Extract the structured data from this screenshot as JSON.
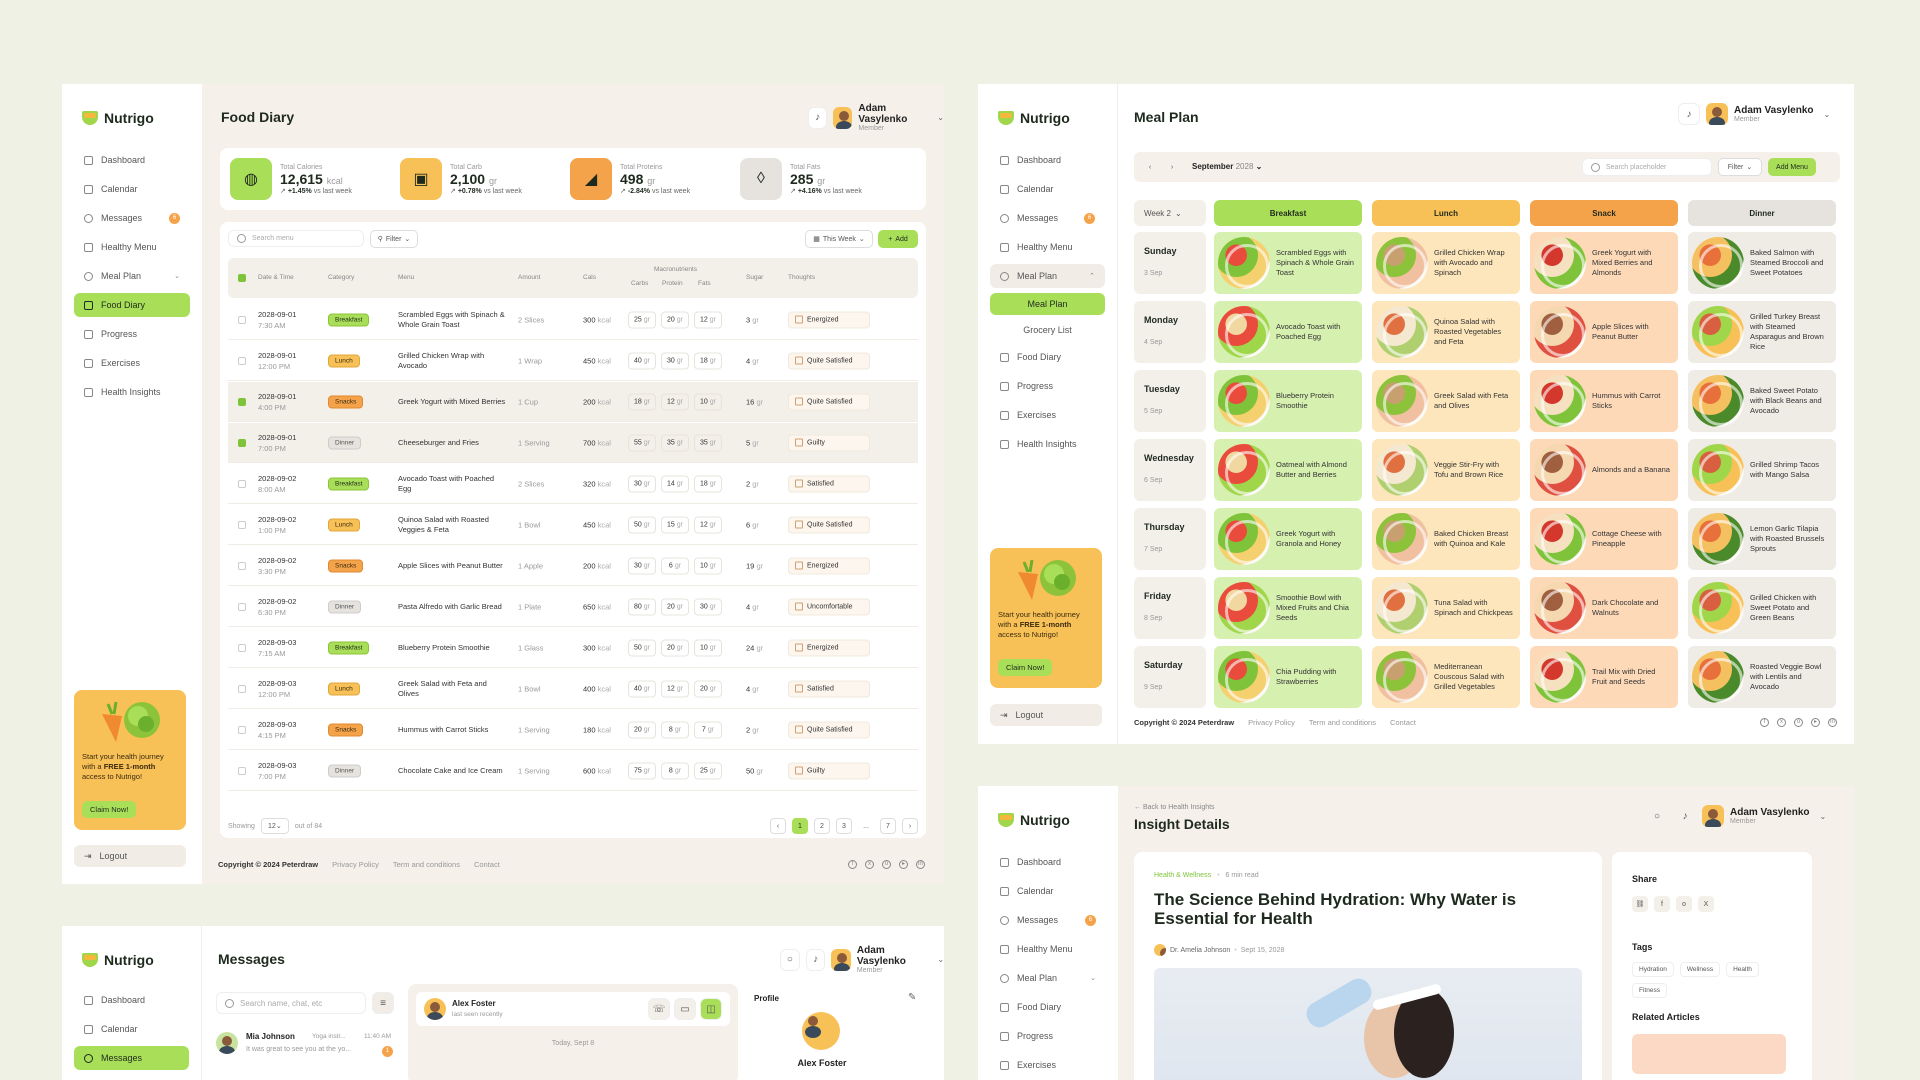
{
  "brand": "Nutrigo",
  "user": {
    "name": "Adam Vasylenko",
    "role": "Member"
  },
  "nav": {
    "dashboard": "Dashboard",
    "calendar": "Calendar",
    "messages": "Messages",
    "messages_badge": "6",
    "healthy_menu": "Healthy Menu",
    "meal_plan": "Meal Plan",
    "food_diary": "Food Diary",
    "progress": "Progress",
    "exercises": "Exercises",
    "health_insights": "Health Insights",
    "sub_meal_plan": "Meal Plan",
    "sub_grocery": "Grocery List",
    "logout": "Logout"
  },
  "promo": {
    "text_pre": "Start your health journey with a ",
    "text_bold": "FREE 1-month",
    "text_post": " access to Nutrigo!",
    "button": "Claim Now!"
  },
  "footer": {
    "copyright": "Copyright © 2024 Peterdraw",
    "privacy": "Privacy Policy",
    "terms": "Term and conditions",
    "contact": "Contact"
  },
  "food_diary": {
    "title": "Food Diary",
    "stats": [
      {
        "label": "Total Calories",
        "value": "12,615",
        "unit": "kcal",
        "change": "+1.45%",
        "suffix": "vs last week",
        "color": "#a9df58",
        "icon": "apple-icon"
      },
      {
        "label": "Total Carb",
        "value": "2,100",
        "unit": "gr",
        "change": "+0.78%",
        "suffix": "vs last week",
        "color": "#f8c157",
        "icon": "bread-icon"
      },
      {
        "label": "Total Proteins",
        "value": "498",
        "unit": "gr",
        "change": "-2.84%",
        "suffix": "vs last week",
        "color": "#f5a34a",
        "icon": "drumstick-icon"
      },
      {
        "label": "Total Fats",
        "value": "285",
        "unit": "gr",
        "change": "+4.16%",
        "suffix": "vs last week",
        "color": "#e6e3de",
        "icon": "drop-icon"
      }
    ],
    "search_placeholder": "Search menu",
    "filter": "Filter",
    "range": "This Week",
    "add": "Add",
    "headers": {
      "date": "Date & Time",
      "category": "Category",
      "menu": "Menu",
      "amount": "Amount",
      "cals": "Cals",
      "macros": "Macronutrients",
      "carbs": "Carbs",
      "protein": "Protein",
      "fats": "Fats",
      "sugar": "Sugar",
      "thoughts": "Thoughts"
    },
    "rows": [
      {
        "date": "2028-09-01",
        "time": "7:30 AM",
        "cat": "Breakfast",
        "menu": "Scrambled Eggs with Spinach & Whole Grain Toast",
        "amount": "2 Slices",
        "cals": "300",
        "carbs": "25",
        "protein": "20",
        "fats": "12",
        "sugar": "3",
        "thought": "Energized",
        "checked": false
      },
      {
        "date": "2028-09-01",
        "time": "12:00 PM",
        "cat": "Lunch",
        "menu": "Grilled Chicken Wrap with Avocado",
        "amount": "1 Wrap",
        "cals": "450",
        "carbs": "40",
        "protein": "30",
        "fats": "18",
        "sugar": "4",
        "thought": "Quite Satisfied",
        "checked": false
      },
      {
        "date": "2028-09-01",
        "time": "4:00 PM",
        "cat": "Snacks",
        "menu": "Greek Yogurt with Mixed Berries",
        "amount": "1 Cup",
        "cals": "200",
        "carbs": "18",
        "protein": "12",
        "fats": "10",
        "sugar": "16",
        "thought": "Quite Satisfied",
        "checked": true
      },
      {
        "date": "2028-09-01",
        "time": "7:00 PM",
        "cat": "Dinner",
        "menu": "Cheeseburger and Fries",
        "amount": "1 Serving",
        "cals": "700",
        "carbs": "55",
        "protein": "35",
        "fats": "35",
        "sugar": "5",
        "thought": "Guilty",
        "checked": true
      },
      {
        "date": "2028-09-02",
        "time": "8:00 AM",
        "cat": "Breakfast",
        "menu": "Avocado Toast with Poached Egg",
        "amount": "2 Slices",
        "cals": "320",
        "carbs": "30",
        "protein": "14",
        "fats": "18",
        "sugar": "2",
        "thought": "Satisfied",
        "checked": false
      },
      {
        "date": "2028-09-02",
        "time": "1:00 PM",
        "cat": "Lunch",
        "menu": "Quinoa Salad with Roasted Veggies & Feta",
        "amount": "1 Bowl",
        "cals": "450",
        "carbs": "50",
        "protein": "15",
        "fats": "12",
        "sugar": "6",
        "thought": "Quite Satisfied",
        "checked": false
      },
      {
        "date": "2028-09-02",
        "time": "3:30 PM",
        "cat": "Snacks",
        "menu": "Apple Slices with Peanut Butter",
        "amount": "1 Apple",
        "cals": "200",
        "carbs": "30",
        "protein": "6",
        "fats": "10",
        "sugar": "19",
        "thought": "Energized",
        "checked": false
      },
      {
        "date": "2028-09-02",
        "time": "6:30 PM",
        "cat": "Dinner",
        "menu": "Pasta Alfredo with Garlic Bread",
        "amount": "1 Plate",
        "cals": "650",
        "carbs": "80",
        "protein": "20",
        "fats": "30",
        "sugar": "4",
        "thought": "Uncomfortable",
        "checked": false
      },
      {
        "date": "2028-09-03",
        "time": "7:15 AM",
        "cat": "Breakfast",
        "menu": "Blueberry Protein Smoothie",
        "amount": "1 Glass",
        "cals": "300",
        "carbs": "50",
        "protein": "20",
        "fats": "10",
        "sugar": "24",
        "thought": "Energized",
        "checked": false
      },
      {
        "date": "2028-09-03",
        "time": "12:00 PM",
        "cat": "Lunch",
        "menu": "Greek Salad with Feta and Olives",
        "amount": "1 Bowl",
        "cals": "400",
        "carbs": "40",
        "protein": "12",
        "fats": "20",
        "sugar": "4",
        "thought": "Satisfied",
        "checked": false
      },
      {
        "date": "2028-09-03",
        "time": "4:15 PM",
        "cat": "Snacks",
        "menu": "Hummus with Carrot Sticks",
        "amount": "1 Serving",
        "cals": "180",
        "carbs": "20",
        "protein": "8",
        "fats": "7",
        "sugar": "2",
        "thought": "Quite Satisfied",
        "checked": false
      },
      {
        "date": "2028-09-03",
        "time": "7:00 PM",
        "cat": "Dinner",
        "menu": "Chocolate Cake and Ice Cream",
        "amount": "1 Serving",
        "cals": "600",
        "carbs": "75",
        "protein": "8",
        "fats": "25",
        "sugar": "50",
        "thought": "Guilty",
        "checked": false
      }
    ],
    "unit_kcal": "kcal",
    "unit_gr": "gr",
    "showing": "Showing",
    "per_page": "12",
    "out_of": "out of 84",
    "pages": [
      "1",
      "2",
      "3",
      "...",
      "7"
    ]
  },
  "meal_plan": {
    "title": "Meal Plan",
    "month": "September",
    "year": "2028",
    "search_placeholder": "Search placeholder",
    "filter": "Filter",
    "add_menu": "Add Menu",
    "week": "Week 2",
    "columns": [
      "Breakfast",
      "Lunch",
      "Snack",
      "Dinner"
    ],
    "days": [
      {
        "day": "Sunday",
        "date": "3 Sep",
        "meals": [
          "Scrambled Eggs with Spinach & Whole Grain Toast",
          "Grilled Chicken Wrap with Avocado and Spinach",
          "Greek Yogurt with Mixed Berries and Almonds",
          "Baked Salmon with Steamed Broccoli and Sweet Potatoes"
        ]
      },
      {
        "day": "Monday",
        "date": "4 Sep",
        "meals": [
          "Avocado Toast with Poached Egg",
          "Quinoa Salad with Roasted Vegetables and Feta",
          "Apple Slices with Peanut Butter",
          "Grilled Turkey Breast with Steamed Asparagus and Brown Rice"
        ]
      },
      {
        "day": "Tuesday",
        "date": "5 Sep",
        "meals": [
          "Blueberry Protein Smoothie",
          "Greek Salad with Feta and Olives",
          "Hummus with Carrot Sticks",
          "Baked Sweet Potato with Black Beans and Avocado"
        ]
      },
      {
        "day": "Wednesday",
        "date": "6 Sep",
        "meals": [
          "Oatmeal with Almond Butter and Berries",
          "Veggie Stir-Fry with Tofu and Brown Rice",
          "Almonds and a Banana",
          "Grilled Shrimp Tacos with Mango Salsa"
        ]
      },
      {
        "day": "Thursday",
        "date": "7 Sep",
        "meals": [
          "Greek Yogurt with Granola and Honey",
          "Baked Chicken Breast with Quinoa and Kale",
          "Cottage Cheese with Pineapple",
          "Lemon Garlic Tilapia with Roasted Brussels Sprouts"
        ]
      },
      {
        "day": "Friday",
        "date": "8 Sep",
        "meals": [
          "Smoothie Bowl with Mixed Fruits and Chia Seeds",
          "Tuna Salad with Spinach and Chickpeas",
          "Dark Chocolate and Walnuts",
          "Grilled Chicken with Sweet Potato and Green Beans"
        ]
      },
      {
        "day": "Saturday",
        "date": "9 Sep",
        "meals": [
          "Chia Pudding with Strawberries",
          "Mediterranean Couscous Salad with Grilled Vegetables",
          "Trail Mix with Dried Fruit and Seeds",
          "Roasted Veggie Bowl with Lentils and Avocado"
        ]
      }
    ]
  },
  "messages": {
    "title": "Messages",
    "search_placeholder": "Search name, chat, etc",
    "contact": {
      "name": "Mia Johnson",
      "tag": "Yoga instr...",
      "time": "11:40 AM",
      "preview": "It was great to see you at the yo...",
      "unread": "1"
    },
    "chat": {
      "name": "Alex Foster",
      "status": "last seen recently",
      "date": "Today, Sept 8"
    },
    "profile": {
      "title": "Profile",
      "name": "Alex Foster"
    }
  },
  "insight": {
    "back": "Back to Health Insights",
    "title": "Insight Details",
    "category": "Health & Wellness",
    "read": "6 min read",
    "headline": "The Science Behind Hydration: Why Water is Essential for Health",
    "author": "Dr. Amelia Johnson",
    "date": "Sept 15, 2028",
    "share": "Share",
    "tags_title": "Tags",
    "tags": [
      "Hydration",
      "Wellness",
      "Health",
      "Fitness"
    ],
    "related": "Related Articles"
  }
}
